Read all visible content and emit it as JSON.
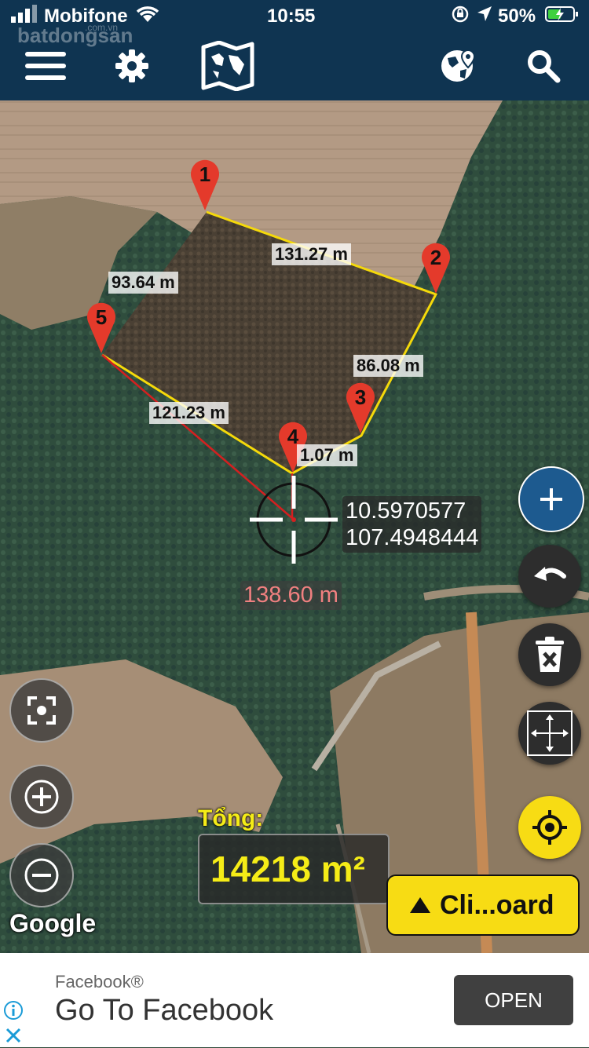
{
  "status_bar": {
    "carrier": "Mobifone",
    "time": "10:55",
    "battery": "50%"
  },
  "watermark": "batdongsan",
  "watermark_sub": ".com.vn",
  "map": {
    "markers": [
      "1",
      "2",
      "3",
      "4",
      "5"
    ],
    "segments": [
      "131.27 m",
      "86.08 m",
      "1.07 m",
      "121.23 m",
      "93.64 m"
    ],
    "latitude": "10.5970577",
    "longitude": "107.4948444",
    "cursor_distance": "138.60 m",
    "total_label": "Tổng:",
    "total_area": "14218 m²",
    "clipboard_label": "Cli...oard",
    "attribution": "Google"
  },
  "ad": {
    "source": "Facebook®",
    "title": "Go To Facebook",
    "cta": "OPEN"
  },
  "colors": {
    "top_bar": "#0f3451",
    "polygon_edge": "#f5d90a",
    "measure_line": "#d42020",
    "accent_yellow": "#f7dc14",
    "add_button": "#1d5a8f",
    "total_text": "#f5ec17"
  },
  "icons": [
    "menu-icon",
    "gear-icon",
    "map-icon",
    "globe-pin-icon",
    "search-icon",
    "plus-icon",
    "undo-icon",
    "trash-icon",
    "fit-bounds-icon",
    "locate-icon",
    "focus-icon",
    "zoom-in-icon",
    "zoom-out-icon",
    "info-icon",
    "close-icon"
  ]
}
